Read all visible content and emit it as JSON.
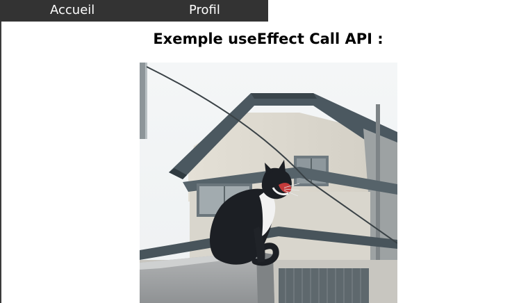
{
  "nav": {
    "links": [
      {
        "label": "Accueil"
      },
      {
        "label": "Profil"
      }
    ]
  },
  "main": {
    "title": "Exemple useEffect Call API :",
    "image": {
      "subject": "cat-on-wall-photo"
    }
  },
  "colors": {
    "navbar_bg": "#333333",
    "nav_text": "#ffffff",
    "page_bg": "#ffffff",
    "title_text": "#000000"
  }
}
